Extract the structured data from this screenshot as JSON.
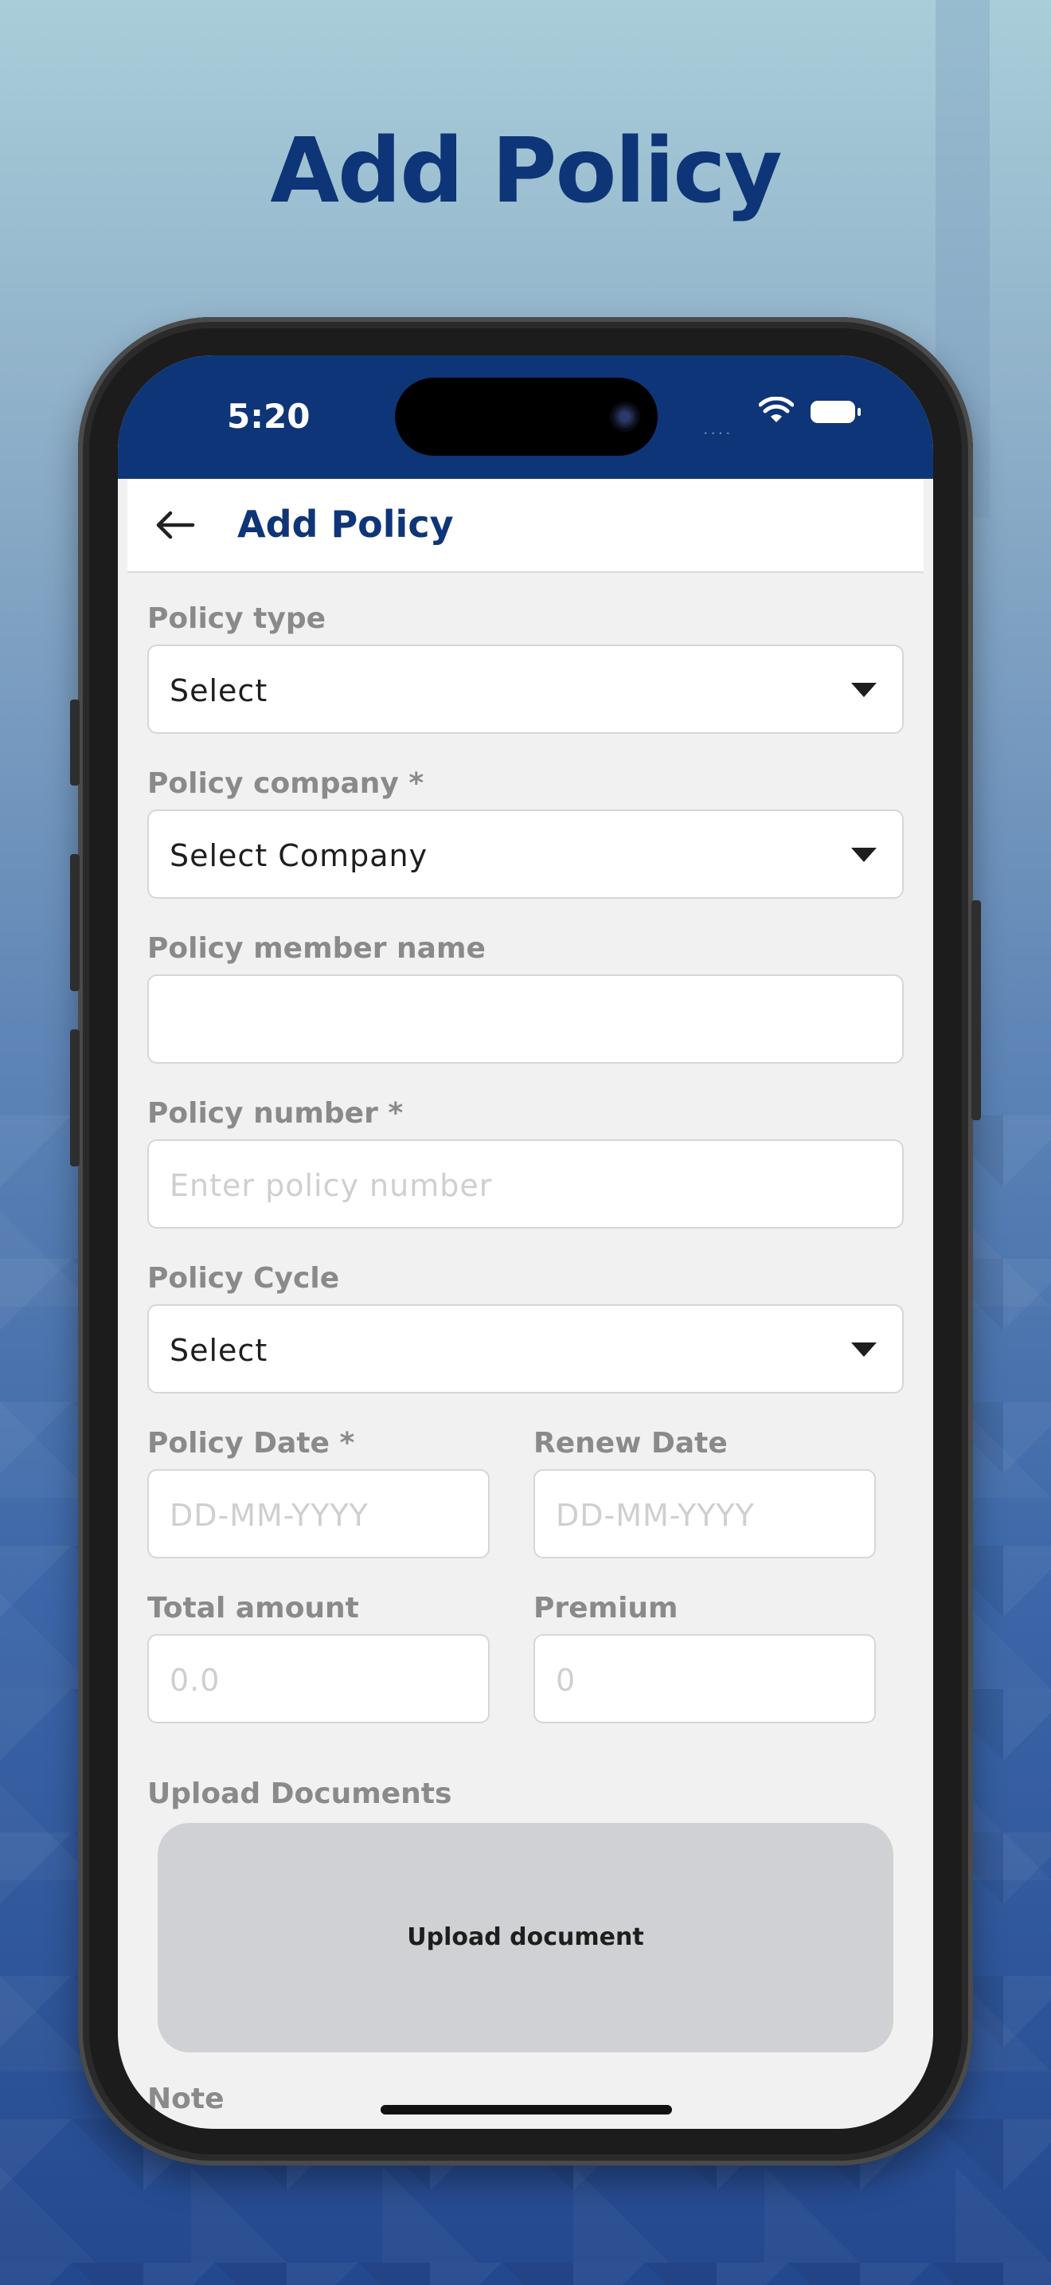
{
  "promo": {
    "title": "Add Policy"
  },
  "status_bar": {
    "time": "5:20",
    "signal": "...."
  },
  "app_bar": {
    "title": "Add Policy"
  },
  "form": {
    "policy_type": {
      "label": "Policy type",
      "value": "Select"
    },
    "policy_company": {
      "label": "Policy company *",
      "value": "Select Company"
    },
    "policy_member_name": {
      "label": "Policy member name",
      "value": ""
    },
    "policy_number": {
      "label": "Policy number *",
      "placeholder": "Enter policy number"
    },
    "policy_cycle": {
      "label": "Policy Cycle",
      "value": "Select"
    },
    "policy_date": {
      "label": "Policy Date *",
      "placeholder": "DD-MM-YYYY"
    },
    "renew_date": {
      "label": "Renew Date",
      "placeholder": "DD-MM-YYYY"
    },
    "total_amount": {
      "label": "Total amount",
      "placeholder": "0.0"
    },
    "premium": {
      "label": "Premium",
      "placeholder": "0"
    },
    "upload": {
      "label": "Upload Documents",
      "button_label": "Upload document"
    },
    "note": {
      "label": "Note"
    }
  }
}
